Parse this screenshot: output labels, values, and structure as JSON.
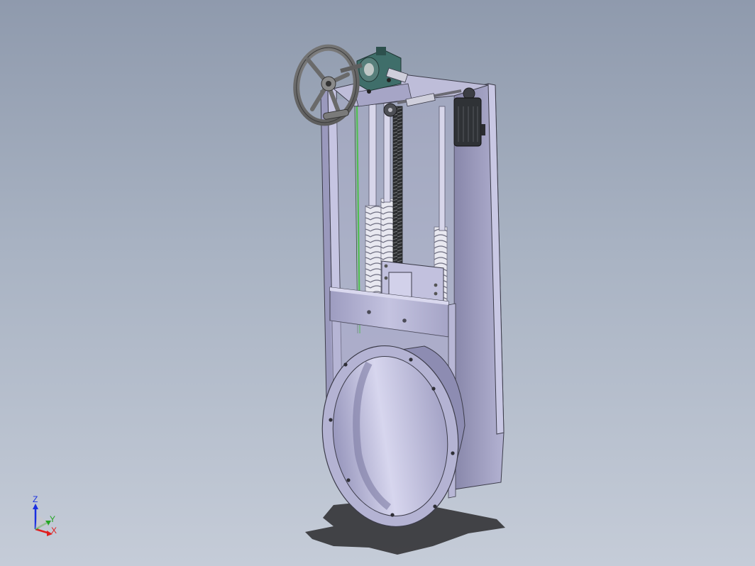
{
  "viewport": {
    "background_top": "#8f9aad",
    "background_bottom": "#c5ccd8"
  },
  "model": {
    "description_icon": "knife-gate-valve-assembly",
    "colors": {
      "frame": "#b9b8d8",
      "frame_shadow": "#8e8db0",
      "edge": "#3c3c4a",
      "handwheel": "#707070",
      "bearing": "#3f6e6a",
      "motor": "#2f3236",
      "spring": "#f1f1f6",
      "rail": "#4fbf4f",
      "shadow": "#3a3a3e"
    }
  },
  "triad": {
    "z_label": "Z",
    "y_label": "Y",
    "x_label": "X",
    "z_color": "#1a2fe0",
    "y_color": "#23a623",
    "x_color": "#e01e1e"
  }
}
